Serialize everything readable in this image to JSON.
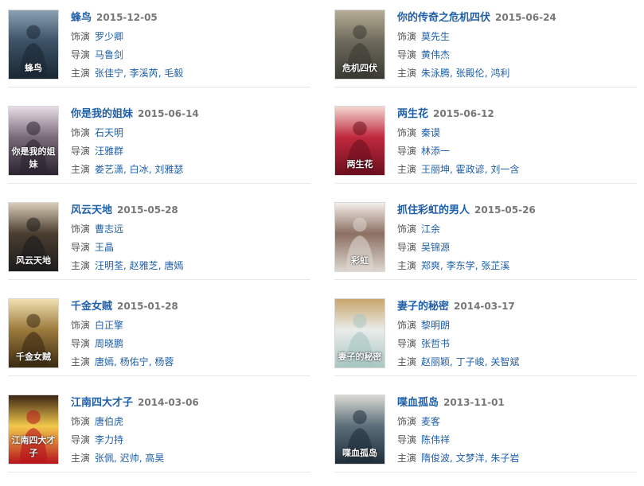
{
  "labels": {
    "role": "饰演",
    "director": "导演",
    "cast": "主演"
  },
  "items": [
    {
      "title": "蜂鸟",
      "date": "2015-12-05",
      "role": "罗少卿",
      "director": "马鲁剑",
      "cast": [
        "张佳宁",
        "李溪芮",
        "毛毅"
      ],
      "poster": "person-in-suit-poster",
      "poster_colors": [
        "#1a2733",
        "#3c5266",
        "#8aa0b3"
      ],
      "poster_text": "蜂鸟"
    },
    {
      "title": "你的传奇之危机四伏",
      "date": "2015-06-24",
      "role": "莫先生",
      "director": "黄伟杰",
      "cast": [
        "朱泳腾",
        "张殿伦",
        "鸿利"
      ],
      "poster": "group-portrait-poster",
      "poster_colors": [
        "#3a3a33",
        "#6e6a5c",
        "#b5ad95"
      ],
      "poster_text": "危机四伏"
    },
    {
      "title": "你是我的姐妹",
      "date": "2015-06-14",
      "role": "石天明",
      "director": "汪雅群",
      "cast": [
        "娄艺潇",
        "白冰",
        "刘雅瑟"
      ],
      "poster": "couple-portrait-poster",
      "poster_colors": [
        "#2b2430",
        "#7a6a78",
        "#e8dde6"
      ],
      "poster_text": "你是我的姐妹"
    },
    {
      "title": "两生花",
      "date": "2015-06-12",
      "role": "秦谟",
      "director": "林添一",
      "cast": [
        "王丽坤",
        "霍政谚",
        "刘一含"
      ],
      "poster": "red-flower-poster",
      "poster_colors": [
        "#6b0f1e",
        "#c0283d",
        "#f2d6d0"
      ],
      "poster_text": "两生花"
    },
    {
      "title": "风云天地",
      "date": "2015-05-28",
      "role": "曹志远",
      "director": "王晶",
      "cast": [
        "汪明荃",
        "赵雅芝",
        "唐嫣"
      ],
      "poster": "calligraphy-poster",
      "poster_colors": [
        "#1d1d1d",
        "#4a3d2f",
        "#d9cdb8"
      ],
      "poster_text": "风云天地"
    },
    {
      "title": "抓住彩虹的男人",
      "date": "2015-05-26",
      "role": "江余",
      "director": "吴锦源",
      "cast": [
        "郑爽",
        "李东学",
        "张芷溪"
      ],
      "poster": "couple-light-poster",
      "poster_colors": [
        "#dcd6cf",
        "#8c6f62",
        "#f4efe9"
      ],
      "poster_text": "彩虹"
    },
    {
      "title": "千金女贼",
      "date": "2015-01-28",
      "role": "白正擎",
      "director": "周晓鹏",
      "cast": [
        "唐嫣",
        "杨佑宁",
        "杨蓉"
      ],
      "poster": "gold-dress-poster",
      "poster_colors": [
        "#3b2a12",
        "#9c7a3c",
        "#f0e0b0"
      ],
      "poster_text": "千金女贼"
    },
    {
      "title": "妻子的秘密",
      "date": "2014-03-17",
      "role": "黎明朗",
      "director": "张哲书",
      "cast": [
        "赵丽颖",
        "丁子峻",
        "关智斌"
      ],
      "poster": "bride-poster",
      "poster_colors": [
        "#a8c6c2",
        "#e9ecea",
        "#c9a66b"
      ],
      "poster_text": "妻子的秘密"
    },
    {
      "title": "江南四大才子",
      "date": "2014-03-06",
      "role": "唐伯虎",
      "director": "李力持",
      "cast": [
        "张佩",
        "迟帅",
        "高昊"
      ],
      "poster": "comedy-costume-poster",
      "poster_colors": [
        "#b8141c",
        "#f2c94c",
        "#3a2414"
      ],
      "poster_text": "江南四大才子"
    },
    {
      "title": "喋血孤岛",
      "date": "2013-11-01",
      "role": "麦客",
      "director": "陈伟祥",
      "cast": [
        "隋俊波",
        "文梦洋",
        "朱子岩"
      ],
      "poster": "soldiers-poster",
      "poster_colors": [
        "#1f2d3a",
        "#5b6e7a",
        "#d9d9d2"
      ],
      "poster_text": "喋血孤岛"
    }
  ]
}
